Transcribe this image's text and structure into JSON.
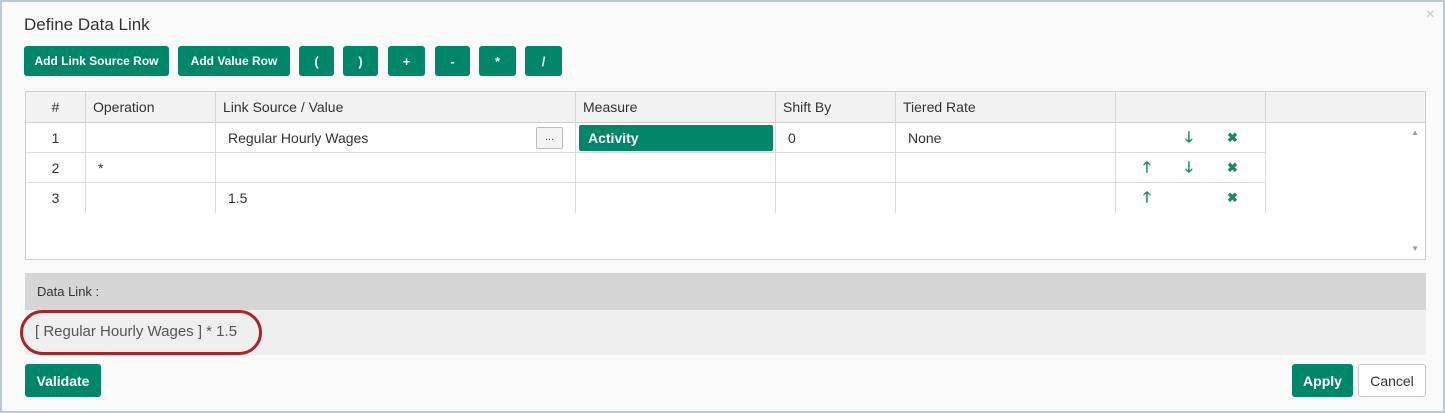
{
  "dialog": {
    "title": "Define Data Link",
    "close_glyph": "×"
  },
  "toolbar": {
    "add_link_source_row": "Add Link Source Row",
    "add_value_row": "Add Value Row",
    "open_paren": "(",
    "close_paren": ")",
    "plus": "+",
    "minus": "-",
    "multiply": "*",
    "divide": "/"
  },
  "grid": {
    "columns": [
      "#",
      "Operation",
      "Link Source / Value",
      "Measure",
      "Shift By",
      "Tiered Rate"
    ],
    "rows": [
      {
        "num": "1",
        "operation": "",
        "source": "Regular Hourly Wages",
        "browse": "...",
        "measure": "Activity",
        "shift_by": "0",
        "tiered_rate": "None"
      },
      {
        "num": "2",
        "operation": "*",
        "source": "",
        "measure": "",
        "shift_by": "",
        "tiered_rate": ""
      },
      {
        "num": "3",
        "operation": "",
        "source": "1.5",
        "measure": "",
        "shift_by": "",
        "tiered_rate": ""
      }
    ],
    "icons": {
      "up": "arrow-up-icon",
      "down": "arrow-down-icon",
      "delete": "close-icon"
    },
    "glyphs": {
      "up": "🡑",
      "down": "🡓",
      "delete": "✖"
    }
  },
  "data_link": {
    "label": "Data Link :",
    "formula": "[ Regular Hourly Wages ] * 1.5"
  },
  "footer": {
    "validate": "Validate",
    "apply": "Apply",
    "cancel": "Cancel"
  },
  "colors": {
    "primary": "#00876a",
    "highlight": "#a82628",
    "icon_green": "#1a8a60"
  }
}
